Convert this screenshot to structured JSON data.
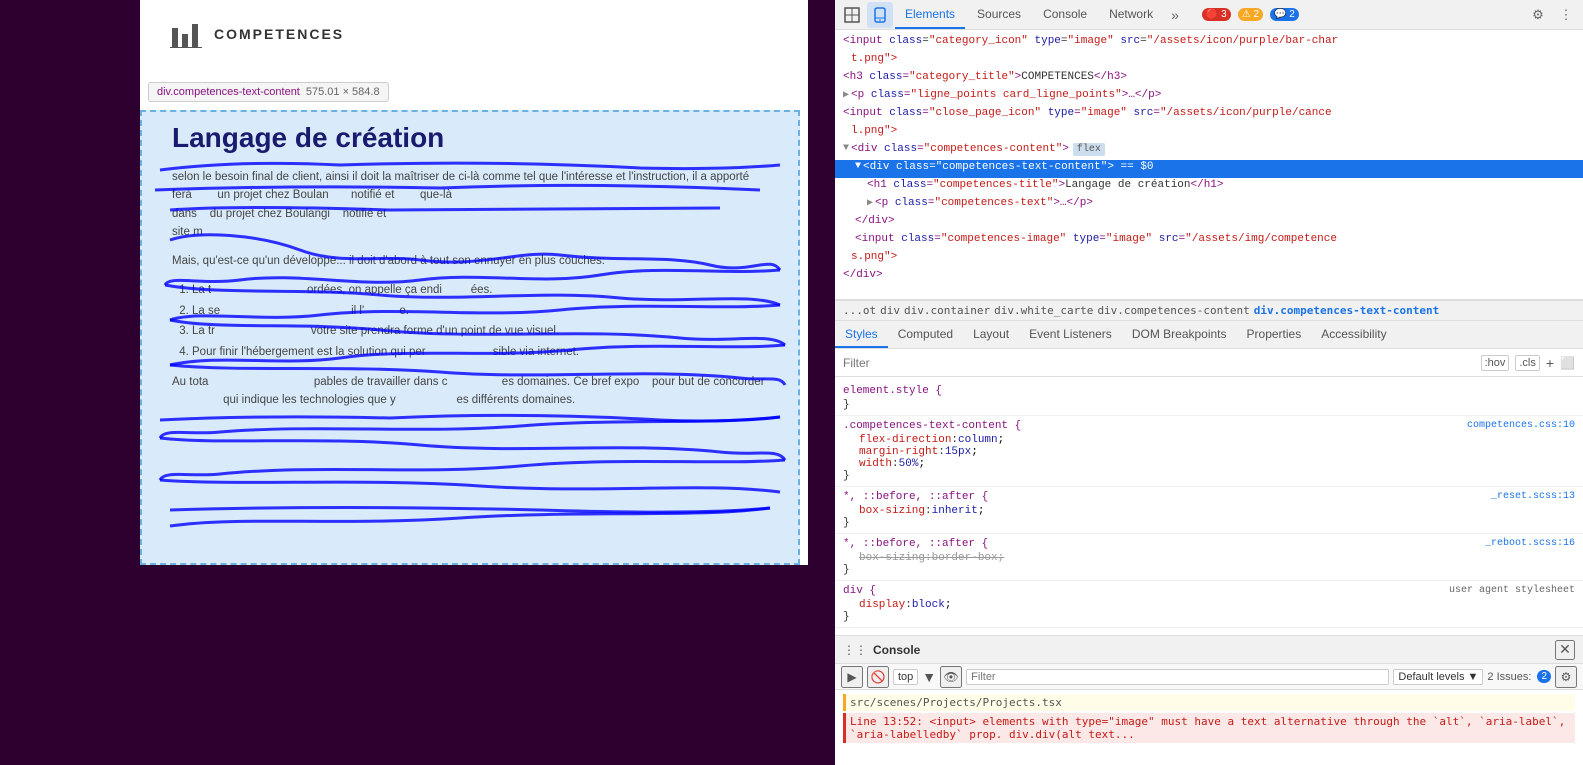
{
  "webpage": {
    "title": "COMPETENCES",
    "tooltip": {
      "tag": "div.competences-text-content",
      "size": "575.01 × 584.8"
    },
    "content": {
      "heading": "Langage de création",
      "paragraphs": [
        "selon le besoin final de client, ainsi il doit la maîtriser de ci-là comme tel que l'intéresse et l'instruction, il a apporté",
        "ferà          un projet chez Boulan         notifié et          que-là",
        "dans   du projet chez Boulangi   notifié et",
        "site m"
      ],
      "subheading": "Mais, qu'est-ce qu'un développe... il doit d'abord à tout son ennuyer en plu couches:",
      "list_items": [
        "1. La t                                                    ordées, on appelle ça endi                       ées.",
        "2. La se                                                                         il l'                       e.",
        "3. La tr                                                   votre site prendra forme d'un point de vue visuel.",
        "4. Pour finir l'hébergement est la solution qui per                                  sible via internet."
      ],
      "footer_text": "Au tota                                              pables de travailler dans c                  es domaines. Ce bref expo   pour but de concorder                    qui indique les technologies que y                    es différents domaines."
    }
  },
  "devtools": {
    "topbar": {
      "tabs": [
        "Elements",
        "Sources",
        "Console",
        "Network"
      ],
      "active_tab": "Elements",
      "more_btn": "»",
      "badges": {
        "errors": "3",
        "warnings": "2",
        "info": "2"
      },
      "icons": {
        "inspect": "⬚",
        "device": "📱",
        "gear": "⚙",
        "dots": "⋮"
      }
    },
    "html": {
      "lines": [
        {
          "indent": 0,
          "content": "<input class=\"category_icon\" type=\"image\" src=\"/assets/icon/purple/bar-char",
          "continuation": "t.png\">"
        },
        {
          "indent": 0,
          "content": "<h3 class=\"category_title\">COMPETENCES</h3>"
        },
        {
          "indent": 0,
          "content": "<p class=\"ligne_points card_ligne_points\">...</p>",
          "expandable": true
        },
        {
          "indent": 0,
          "content": "<input class=\"close_page_icon\" type=\"image\" src=\"/assets/icon/purple/cance",
          "continuation": "l.png\">"
        },
        {
          "indent": 0,
          "content": "<div class=\"competences-content\">",
          "badge": "flex",
          "expandable": true
        },
        {
          "indent": 1,
          "content": "<div class=\"competences-text-content\"> == $0",
          "selected": true,
          "expandable": true
        },
        {
          "indent": 2,
          "content": "<h1 class=\"competences-title\">Langage de création</h1>"
        },
        {
          "indent": 2,
          "content": "<p class=\"competences-text\">...</p>",
          "expandable": true
        },
        {
          "indent": 1,
          "content": "</div>"
        },
        {
          "indent": 1,
          "content": "<input class=\"competences-image\" type=\"image\" src=\"/assets/img/competence",
          "continuation": "s.png\">"
        },
        {
          "indent": 0,
          "content": "</div>"
        }
      ]
    },
    "breadcrumb": {
      "items": [
        "...ot",
        "div",
        "div.container",
        "div.white_carte",
        "div.competences-content",
        "div.competences-text-content"
      ]
    },
    "styles_tabs": [
      "Styles",
      "Computed",
      "Layout",
      "Event Listeners",
      "DOM Breakpoints",
      "Properties",
      "Accessibility"
    ],
    "active_styles_tab": "Styles",
    "filter": {
      "placeholder": "Filter",
      "hov_label": ":hov",
      "cls_label": ".cls",
      "plus_label": "+",
      "fullscreen_label": "⬜"
    },
    "css_rules": [
      {
        "selector": "element.style {",
        "source": "",
        "properties": [],
        "close": "}"
      },
      {
        "selector": ".competences-text-content {",
        "source": "competences.css:10",
        "properties": [
          {
            "prop": "flex-direction",
            "value": "column",
            "strikethrough": false
          },
          {
            "prop": "margin-right",
            "value": "15px",
            "strikethrough": false
          },
          {
            "prop": "width",
            "value": "50%",
            "strikethrough": false
          }
        ],
        "close": "}"
      },
      {
        "selector": "*, ::before, ::after {",
        "source": "_reset.scss:13",
        "properties": [
          {
            "prop": "box-sizing",
            "value": "inherit",
            "strikethrough": false
          }
        ],
        "close": "}"
      },
      {
        "selector": "*, ::before, ::after {",
        "source": "_reboot.scss:16",
        "properties": [
          {
            "prop": "box-sizing",
            "value": "border-box",
            "strikethrough": true
          }
        ],
        "close": "}"
      },
      {
        "selector": "div {",
        "source": "user agent stylesheet",
        "properties": [
          {
            "prop": "display",
            "value": "block",
            "strikethrough": false
          }
        ],
        "close": "}"
      }
    ],
    "console": {
      "title": "Console",
      "toolbar": {
        "play_label": "▶",
        "stop_label": "🚫",
        "top_label": "top",
        "eye_label": "👁",
        "filter_placeholder": "Filter",
        "level_label": "Default levels ▼",
        "issues_label": "2 Issues:",
        "issues_count": "2",
        "gear_label": "⚙"
      },
      "messages": [
        {
          "type": "warn",
          "text": "src/scenes/Projects/Projects.tsx"
        },
        {
          "type": "error",
          "text": "Line 13:52: <input> elements with type=\"image\" must have a text alternative through the `alt`, `aria-label`, `aria-labelledby` prop. div.div(alt text..."
        }
      ]
    }
  }
}
